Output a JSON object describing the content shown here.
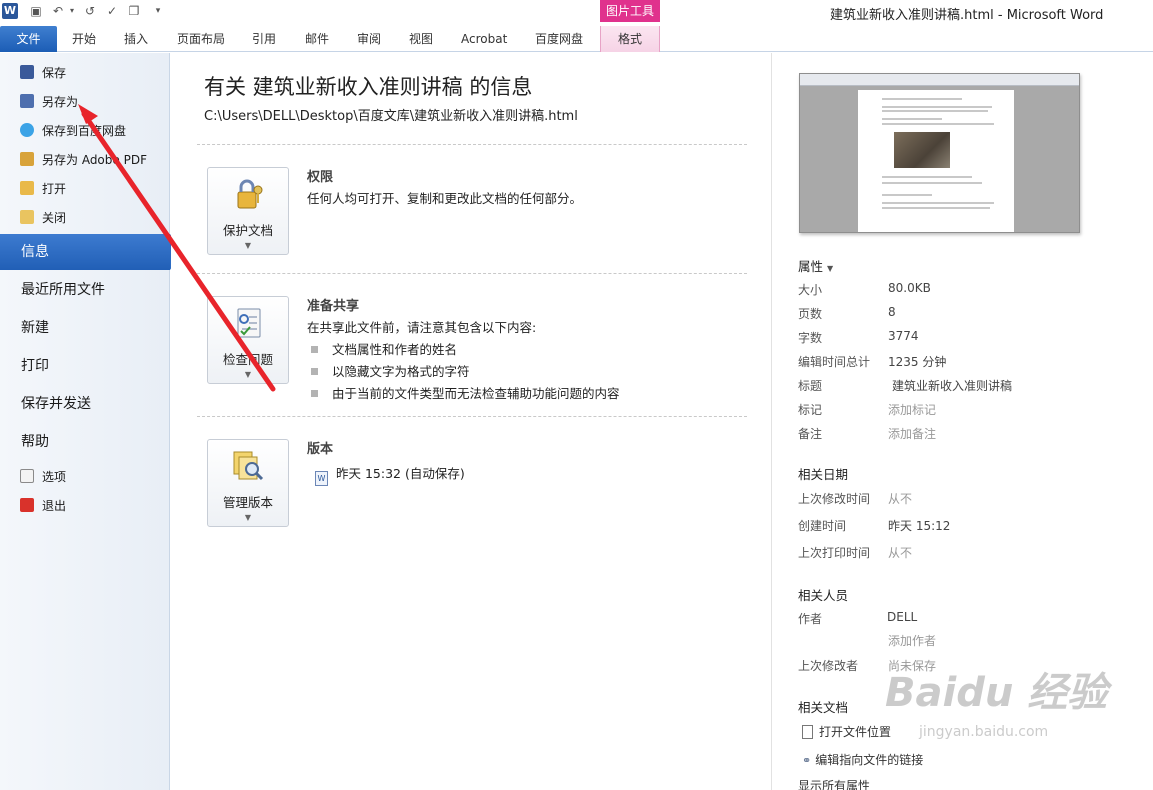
{
  "window": {
    "title": "建筑业新收入准则讲稿.html - Microsoft Word",
    "logo_letter": "W",
    "contextual_group": "图片工具"
  },
  "ribbon": {
    "tabs": [
      "文件",
      "开始",
      "插入",
      "页面布局",
      "引用",
      "邮件",
      "审阅",
      "视图",
      "Acrobat",
      "百度网盘",
      "格式"
    ]
  },
  "nav": {
    "small_top": [
      "保存",
      "另存为",
      "保存到百度网盘",
      "另存为 Adobe PDF",
      "打开",
      "关闭"
    ],
    "big": [
      "信息",
      "最近所用文件",
      "新建",
      "打印",
      "保存并发送",
      "帮助"
    ],
    "small_bottom": [
      "选项",
      "退出"
    ]
  },
  "info": {
    "heading": "有关 建筑业新收入准则讲稿 的信息",
    "path": "C:\\Users\\DELL\\Desktop\\百度文库\\建筑业新收入准则讲稿.html",
    "sections": {
      "permissions": {
        "button": "保护文档",
        "title": "权限",
        "text": "任何人均可打开、复制和更改此文档的任何部分。"
      },
      "prepare": {
        "button": "检查问题",
        "title": "准备共享",
        "text": "在共享此文件前，请注意其包含以下内容:",
        "bullets": [
          "文档属性和作者的姓名",
          "以隐藏文字为格式的字符",
          "由于当前的文件类型而无法检查辅助功能问题的内容"
        ]
      },
      "versions": {
        "button": "管理版本",
        "title": "版本",
        "entry": "昨天 15:32 (自动保存)"
      }
    }
  },
  "properties": {
    "header": "属性",
    "rows": [
      {
        "k": "大小",
        "v": "80.0KB"
      },
      {
        "k": "页数",
        "v": "8"
      },
      {
        "k": "字数",
        "v": "3774"
      },
      {
        "k": "编辑时间总计",
        "v": "1235 分钟"
      },
      {
        "k": "标题",
        "v": "建筑业新收入准则讲稿"
      },
      {
        "k": "标记",
        "v": "添加标记"
      },
      {
        "k": "备注",
        "v": "添加备注"
      }
    ],
    "dates_header": "相关日期",
    "dates": [
      {
        "k": "上次修改时间",
        "v": "从不"
      },
      {
        "k": "创建时间",
        "v": "昨天 15:12"
      },
      {
        "k": "上次打印时间",
        "v": "从不"
      }
    ],
    "people_header": "相关人员",
    "author_label": "作者",
    "author": "DELL",
    "add_author": "添加作者",
    "last_modified_by_label": "上次修改者",
    "last_modified_by": "尚未保存",
    "docs_header": "相关文档",
    "open_location": "打开文件位置",
    "edit_links": "编辑指向文件的链接",
    "show_all": "显示所有属性"
  },
  "watermark": {
    "line1": "Baidu 经验",
    "line2": "jingyan.baidu.com"
  },
  "colors": {
    "accent": "#2b579a",
    "annotation": "#e8242b",
    "format_tab": "#e0328d"
  }
}
